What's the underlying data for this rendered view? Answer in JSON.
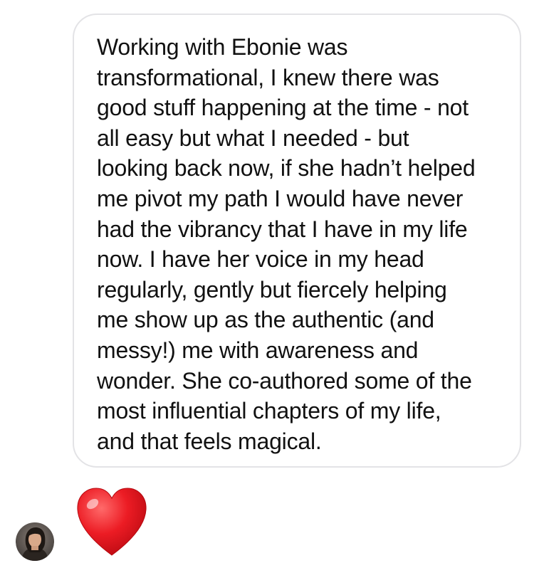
{
  "conversation": {
    "message": {
      "lines": [
        "Working with Ebonie was",
        "transformational, I knew there was",
        "good stuff happening at the time - not",
        "all easy but what I needed - but",
        "looking back now, if she hadn’t helped",
        "me pivot my path I would have never",
        "had the vibrancy that I have in my life",
        "now. I have her voice in my head",
        "regularly, gently but fiercely helping",
        "me show up as the authentic (and",
        "messy!) me with awareness and",
        "wonder. She co-authored some of the",
        "most influential chapters of my life,",
        "and that feels magical."
      ]
    },
    "reaction": {
      "icon": "red-heart-icon",
      "color": "#e8141e"
    },
    "sender": {
      "avatar": "profile-photo"
    }
  },
  "colors": {
    "bubble_border": "#e3e3e6",
    "text": "#111111",
    "background": "#ffffff"
  }
}
